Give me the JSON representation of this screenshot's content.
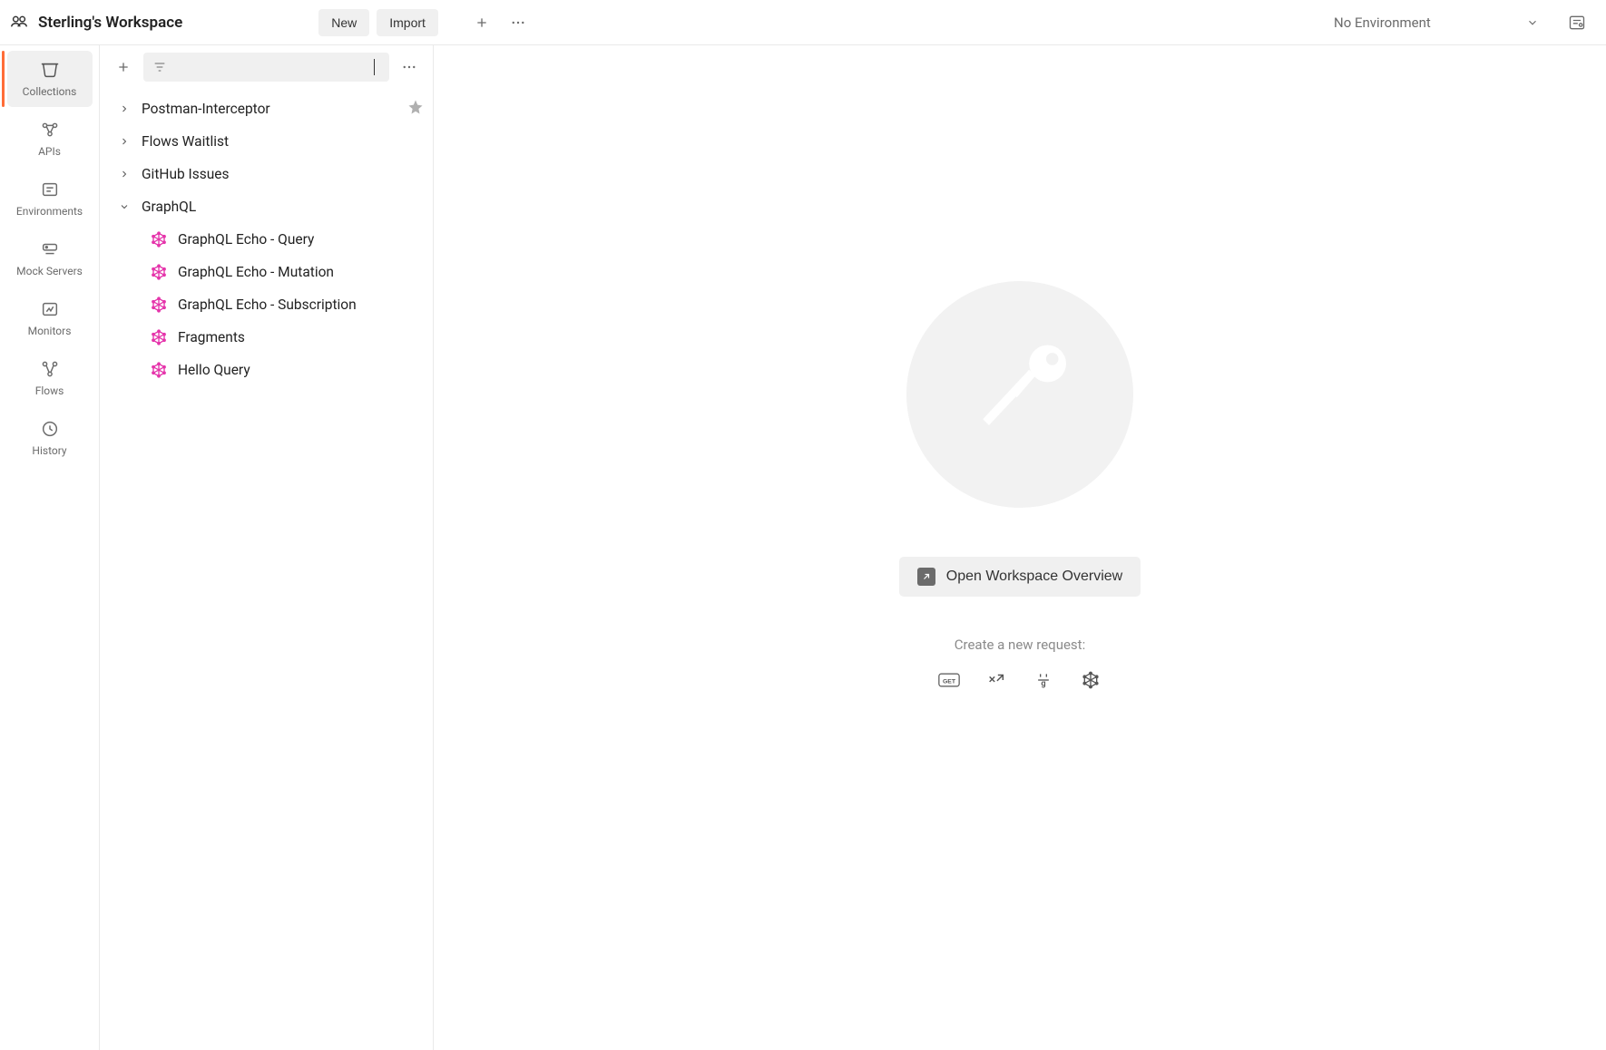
{
  "header": {
    "workspace_name": "Sterling's Workspace",
    "new_label": "New",
    "import_label": "Import",
    "environment_label": "No Environment"
  },
  "rail": {
    "items": [
      {
        "label": "Collections"
      },
      {
        "label": "APIs"
      },
      {
        "label": "Environments"
      },
      {
        "label": "Mock Servers"
      },
      {
        "label": "Monitors"
      },
      {
        "label": "Flows"
      },
      {
        "label": "History"
      }
    ]
  },
  "sidebar": {
    "collections": [
      {
        "label": "Postman-Interceptor",
        "starred": true
      },
      {
        "label": "Flows Waitlist"
      },
      {
        "label": "GitHub Issues"
      },
      {
        "label": "GraphQL",
        "expanded": true
      }
    ],
    "graphql_children": [
      {
        "label": "GraphQL Echo - Query"
      },
      {
        "label": "GraphQL Echo - Mutation"
      },
      {
        "label": "GraphQL Echo - Subscription"
      },
      {
        "label": "Fragments"
      },
      {
        "label": "Hello Query"
      }
    ]
  },
  "main": {
    "overview_label": "Open Workspace Overview",
    "create_label": "Create a new request:"
  }
}
